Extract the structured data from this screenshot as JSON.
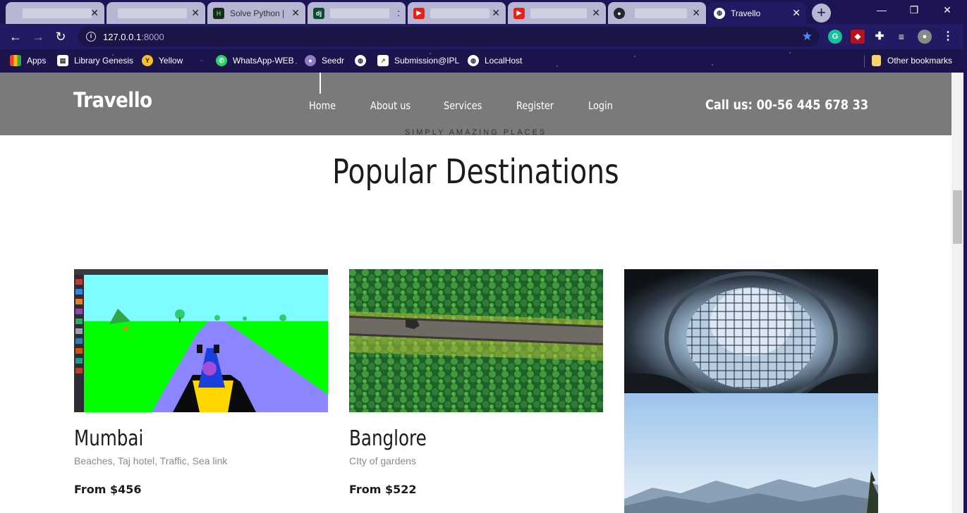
{
  "browser": {
    "tabs": [
      {
        "title": "",
        "favicon": "blank",
        "active": false
      },
      {
        "title": "",
        "favicon": "blank",
        "active": false
      },
      {
        "title": "Solve Python |",
        "favicon": "hackerrank-icon",
        "active": false
      },
      {
        "title": "",
        "favicon": "django-icon",
        "active": false
      },
      {
        "title": "",
        "favicon": "youtube-icon",
        "active": false
      },
      {
        "title": "",
        "favicon": "youtube-icon",
        "active": false
      },
      {
        "title": "",
        "favicon": "github-icon",
        "active": false
      },
      {
        "title": "Travello",
        "favicon": "globe-icon",
        "active": true
      }
    ],
    "address": {
      "host": "127.0.0.1",
      "port": ":8000"
    },
    "bookmarks": [
      {
        "label": "Apps",
        "icon": "apps-grid-icon"
      },
      {
        "label": "Library Genesis",
        "icon": "library-icon"
      },
      {
        "label": "Yellow",
        "icon": "yellow-icon"
      },
      {
        "label": "",
        "icon": "dots-icon"
      },
      {
        "label": "WhatsApp-WEB",
        "icon": "whatsapp-icon"
      },
      {
        "label": "Seedr",
        "icon": "seedr-icon"
      },
      {
        "label": "",
        "icon": "globe-icon"
      },
      {
        "label": "Submission@IPL",
        "icon": "chart-icon"
      },
      {
        "label": "LocalHost",
        "icon": "globe-icon"
      }
    ],
    "other_bookmarks": "Other bookmarks",
    "colors": {
      "tabbar": "#1d1553",
      "toolbar": "#221a63",
      "accent_star": "#4c8dff"
    }
  },
  "site": {
    "logo": "Travello",
    "nav": [
      {
        "label": "Home",
        "active": true
      },
      {
        "label": "About us",
        "active": false
      },
      {
        "label": "Services",
        "active": false
      },
      {
        "label": "Register",
        "active": false
      },
      {
        "label": "Login",
        "active": false
      }
    ],
    "call": "Call us: 00-56 445 678 33",
    "header_color": "#7a7a7a"
  },
  "section": {
    "tagline": "SIMPLY AMAZING PLACES",
    "title": "Popular Destinations"
  },
  "destinations": [
    {
      "name": "Mumbai",
      "description": "Beaches, Taj hotel, Traffic, Sea link",
      "price": "From $456",
      "image": "racing-game-screenshot"
    },
    {
      "name": "Banglore",
      "description": "CIty of gardens",
      "price": "From $522",
      "image": "aerial-bridge-over-greenery"
    }
  ],
  "extra_image": "dome-and-mountains"
}
